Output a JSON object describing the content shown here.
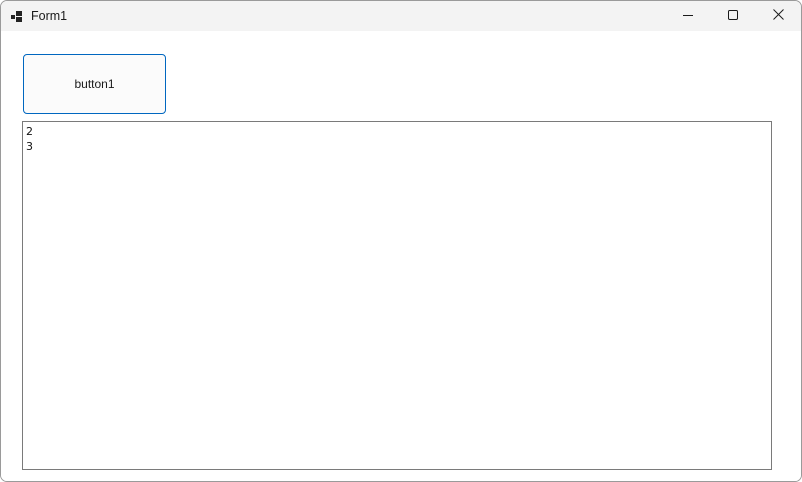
{
  "window": {
    "title": "Form1"
  },
  "titlebar": {
    "icon": "winforms-app-icon",
    "minimize_icon": "minimize-icon",
    "maximize_icon": "maximize-icon",
    "close_icon": "close-icon"
  },
  "form": {
    "button1_label": "button1",
    "listbox_items": [
      "2",
      "3"
    ]
  },
  "colors": {
    "titlebar_bg": "#f3f3f3",
    "button_border": "#0067c0",
    "listbox_border": "#7a7a7a"
  }
}
